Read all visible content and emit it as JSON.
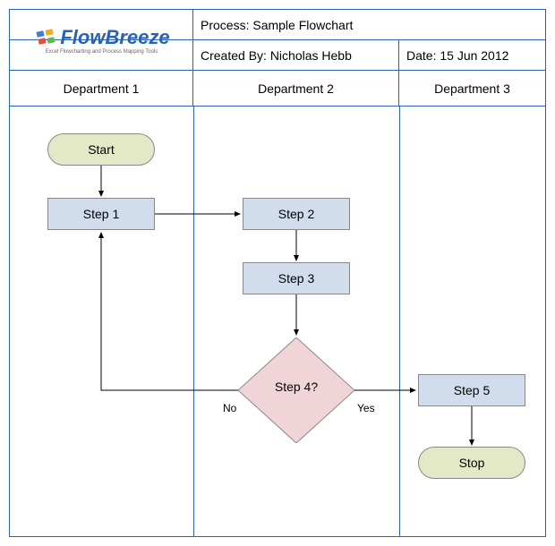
{
  "header": {
    "logo_name": "FlowBreeze",
    "logo_tagline": "Excel Flowcharting and Process Mapping Tools",
    "process_label": "Process: Sample Flowchart",
    "created_by_label": "Created By: Nicholas Hebb",
    "date_label": "Date: 15 Jun 2012"
  },
  "departments": {
    "d1": "Department 1",
    "d2": "Department 2",
    "d3": "Department 3"
  },
  "nodes": {
    "start": "Start",
    "step1": "Step 1",
    "step2": "Step 2",
    "step3": "Step 3",
    "step4": "Step 4?",
    "step5": "Step 5",
    "stop": "Stop"
  },
  "edges": {
    "no_label": "No",
    "yes_label": "Yes"
  }
}
